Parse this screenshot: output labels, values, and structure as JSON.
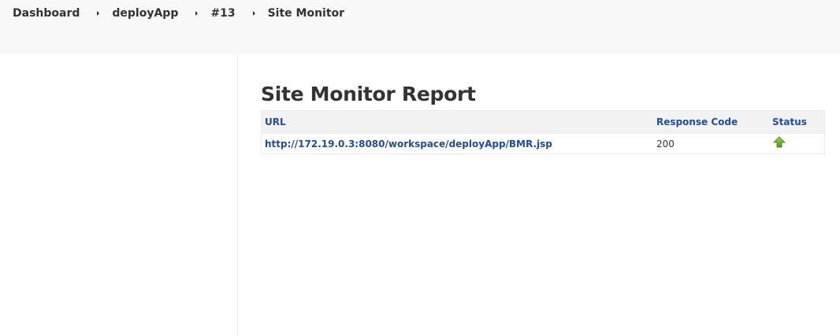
{
  "breadcrumb": {
    "items": [
      {
        "label": "Dashboard"
      },
      {
        "label": "deployApp"
      },
      {
        "label": "#13"
      },
      {
        "label": "Site Monitor"
      }
    ]
  },
  "page": {
    "title": "Site Monitor Report"
  },
  "table": {
    "headers": {
      "url": "URL",
      "response_code": "Response Code",
      "status": "Status"
    },
    "rows": [
      {
        "url": "http://172.19.0.3:8080/workspace/deployApp/BMR.jsp",
        "response_code": "200",
        "status_icon": "up-arrow-icon",
        "status_color": "#6fb23b"
      }
    ]
  },
  "colors": {
    "link": "#1f4ea1",
    "topbar_bg": "#f8f8f8",
    "header_bg": "#f2f2f2"
  }
}
